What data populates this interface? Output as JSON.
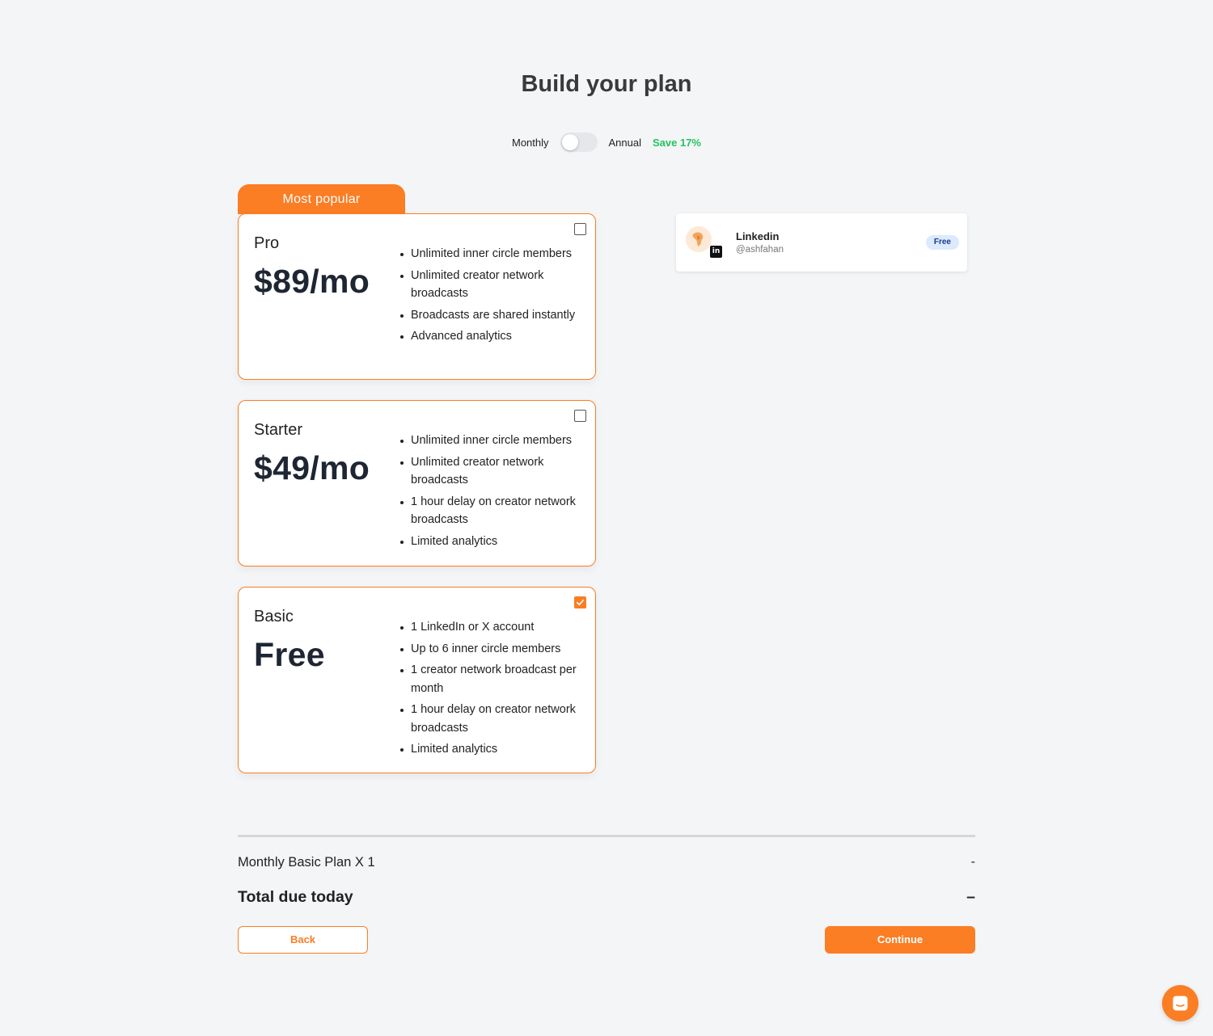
{
  "page": {
    "title": "Build your plan"
  },
  "billing": {
    "monthly_label": "Monthly",
    "annual_label": "Annual",
    "save_label": "Save 17%",
    "selected": "Monthly"
  },
  "popular_label": "Most popular",
  "plans": [
    {
      "name": "Pro",
      "price": "$89/mo",
      "selected": false,
      "features": [
        "Unlimited inner circle members",
        "Unlimited creator network broadcasts",
        "Broadcasts are shared instantly",
        "Advanced analytics"
      ]
    },
    {
      "name": "Starter",
      "price": "$49/mo",
      "selected": false,
      "features": [
        "Unlimited inner circle members",
        "Unlimited creator network broadcasts",
        "1 hour delay on creator network broadcasts",
        "Limited analytics"
      ]
    },
    {
      "name": "Basic",
      "price": "Free",
      "selected": true,
      "features": [
        "1 LinkedIn or X account",
        "Up to 6 inner circle members",
        "1 creator network broadcast per month",
        "1 hour delay on creator network broadcasts",
        "Limited analytics"
      ]
    }
  ],
  "account": {
    "name": "Linkedin",
    "handle": "@ashfahan",
    "badge": "Free",
    "platform_icon": "linkedin-icon"
  },
  "summary": {
    "line_label": "Monthly Basic Plan X 1",
    "line_value": "-",
    "total_label": "Total due today",
    "total_value": "–"
  },
  "actions": {
    "back": "Back",
    "continue": "Continue"
  },
  "colors": {
    "accent": "#fb7d24",
    "save_green": "#22c55e",
    "badge_bg": "#dbeafe",
    "background": "#f4f5f7"
  }
}
